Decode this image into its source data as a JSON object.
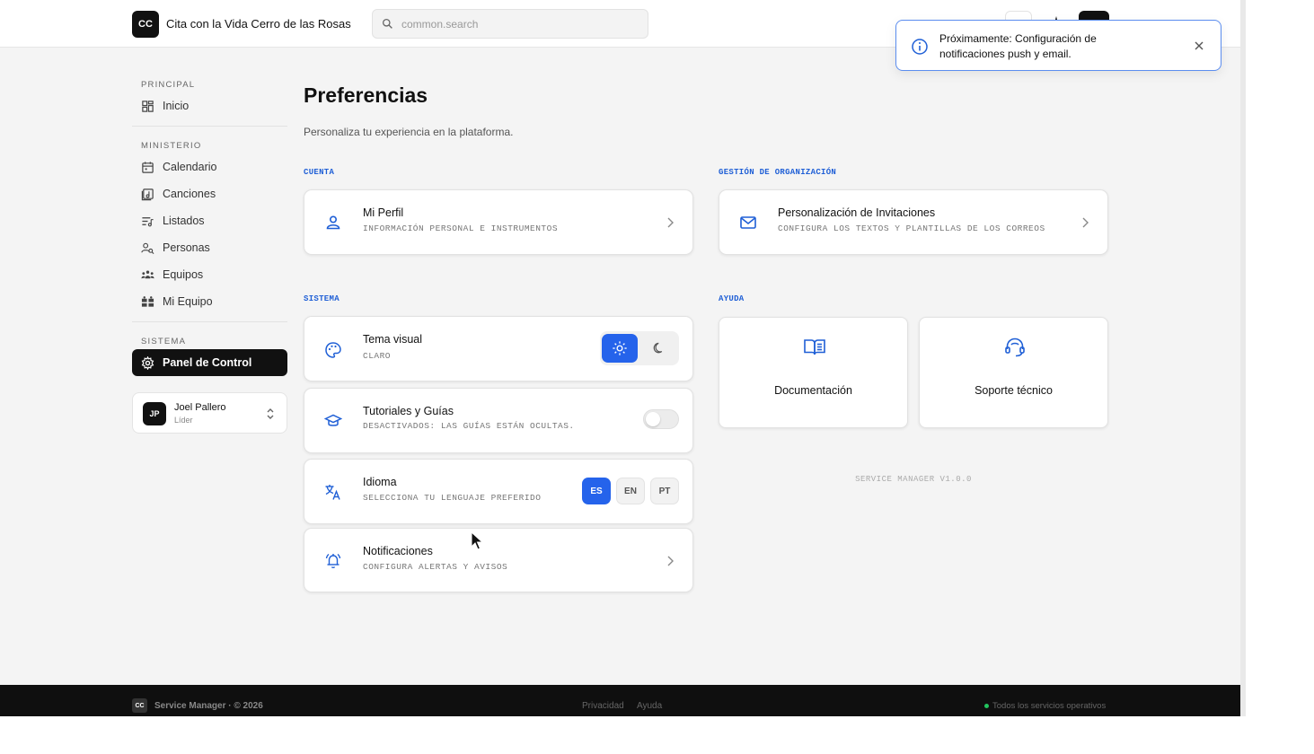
{
  "header": {
    "logo_text": "CC",
    "org_name": "Cita con la Vida Cerro de las Rosas",
    "search_placeholder": "common.search"
  },
  "sidebar": {
    "sections": [
      {
        "label": "PRINCIPAL"
      },
      {
        "label": "MINISTERIO"
      },
      {
        "label": "SISTEMA"
      }
    ],
    "items": [
      {
        "label": "Inicio",
        "icon": "dashboard-icon"
      },
      {
        "label": "Calendario",
        "icon": "calendar-icon"
      },
      {
        "label": "Canciones",
        "icon": "music-icon"
      },
      {
        "label": "Listados",
        "icon": "playlist-icon"
      },
      {
        "label": "Personas",
        "icon": "people-icon"
      },
      {
        "label": "Equipos",
        "icon": "teams-icon"
      },
      {
        "label": "Mi Equipo",
        "icon": "my-team-icon"
      },
      {
        "label": "Panel de Control",
        "icon": "settings-gear-icon",
        "active": true
      }
    ],
    "user": {
      "initials": "JP",
      "name": "Joel Pallero",
      "role": "Líder"
    }
  },
  "main": {
    "title": "Preferencias",
    "subtitle": "Personaliza tu experiencia en la plataforma.",
    "groups": {
      "account": "CUENTA",
      "org": "GESTIÓN DE ORGANIZACIÓN",
      "system": "SISTEMA",
      "help": "AYUDA"
    },
    "profile": {
      "title": "Mi Perfil",
      "desc": "INFORMACIÓN PERSONAL E INSTRUMENTOS"
    },
    "invitations": {
      "title": "Personalización de Invitaciones",
      "desc": "CONFIGURA LOS TEXTOS Y PLANTILLAS DE LOS CORREOS"
    },
    "theme": {
      "title": "Tema visual",
      "desc": "CLARO",
      "selected": "light"
    },
    "tutorials": {
      "title": "Tutoriales y Guías",
      "desc": "DESACTIVADOS: LAS GUÍAS ESTÁN OCULTAS.",
      "enabled": false
    },
    "language": {
      "title": "Idioma",
      "desc": "SELECCIONA TU LENGUAJE PREFERIDO",
      "options": [
        "ES",
        "EN",
        "PT"
      ],
      "selected": "ES"
    },
    "notifications": {
      "title": "Notificaciones",
      "desc": "CONFIGURA ALERTAS Y AVISOS"
    },
    "help_cards": [
      {
        "label": "Documentación",
        "icon": "book-icon"
      },
      {
        "label": "Soporte técnico",
        "icon": "headset-icon"
      }
    ],
    "version": "SERVICE MANAGER V1.0.0"
  },
  "toast": {
    "message": "Próximamente: Configuración de notificaciones push y email."
  },
  "footer": {
    "logo_text": "CC",
    "brand": "Service Manager · © 2026",
    "links": [
      "Privacidad",
      "Ayuda"
    ],
    "status": "Todos los servicios operativos"
  },
  "colors": {
    "accent": "#2563eb",
    "group_label": "#1f5fd6",
    "dark": "#111111",
    "status_ok": "#22c55e"
  }
}
